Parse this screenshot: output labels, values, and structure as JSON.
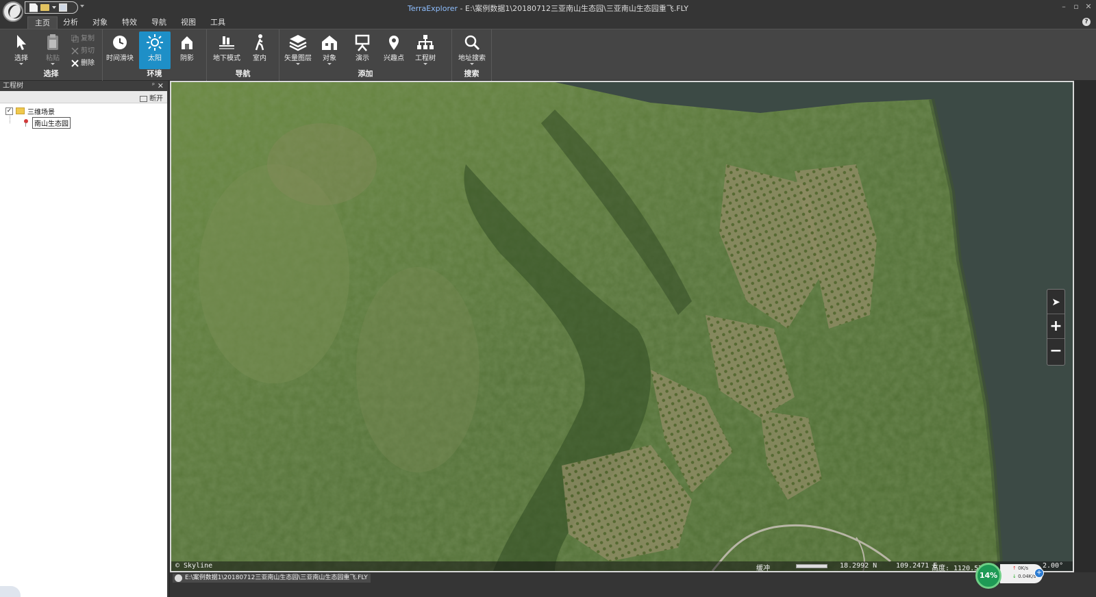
{
  "titlebar": {
    "app_name": "TerraExplorer",
    "separator": " - ",
    "file_path": "E:\\案例数据1\\20180712三亚南山生态园\\三亚南山生态园重飞.FLY",
    "minimize": "–",
    "maximize": "▫",
    "close": "✕"
  },
  "tabs": [
    "主页",
    "分析",
    "对象",
    "特效",
    "导航",
    "视图",
    "工具"
  ],
  "active_tab": "主页",
  "ribbon": {
    "select_group": {
      "label": "选择",
      "select": "选择",
      "paste": "粘贴",
      "copy": "复制",
      "cut": "剪切",
      "delete": "删除"
    },
    "env_group": {
      "label": "环境",
      "time_slider": "时间滑块",
      "sun": "太阳",
      "shadow": "阴影"
    },
    "nav_group": {
      "label": "导航",
      "underground": "地下模式",
      "indoor": "室内"
    },
    "add_group": {
      "label": "添加",
      "vector_layer": "矢量图层",
      "object": "对象",
      "presentation": "演示",
      "poi": "兴趣点",
      "project_tree": "工程树"
    },
    "search_group": {
      "label": "搜索",
      "address_search": "地址搜索"
    }
  },
  "tree_panel": {
    "title": "工程树",
    "pin": "ᵖ",
    "close": "✕",
    "disconnect": "断开",
    "items": [
      {
        "label": "三维场景",
        "checked": "✓"
      },
      {
        "label": "南山生态园"
      }
    ]
  },
  "map": {
    "copyright": "© Skyline",
    "buffer_label": "缓冲",
    "lat": "18.2992 N",
    "lon": "109.2471 E",
    "altitude": "高度: 1120.57",
    "heading": "2.00°",
    "nav_north": "➤",
    "nav_zoom_in": "+",
    "nav_zoom_out": "−"
  },
  "statusbar": {
    "path": "E:\\案例数据1\\20180712三亚南山生态园\\三亚南山生态园重飞.FLY",
    "cpu": "14%",
    "net_up": "0K/s",
    "net_down": "0.04K/s",
    "net_plus": "+"
  },
  "colors": {
    "accent": "#1e8fc7",
    "ribbon_bg": "#454545",
    "titlebar_bg": "#353535",
    "water": "#3b4a45",
    "vegetation": "#5d7a38"
  }
}
